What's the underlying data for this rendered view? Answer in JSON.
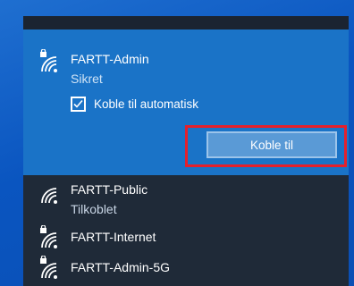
{
  "networks": [
    {
      "name": "FARTT-Admin",
      "status": "Sikret",
      "secured": true,
      "selected": true
    },
    {
      "name": "FARTT-Public",
      "status": "Tilkoblet",
      "secured": false
    },
    {
      "name": "FARTT-Internet",
      "status": "",
      "secured": true
    },
    {
      "name": "FARTT-Admin-5G",
      "status": "",
      "secured": true
    }
  ],
  "auto_connect": {
    "label": "Koble til automatisk",
    "checked": true
  },
  "connect_button": {
    "label": "Koble til"
  },
  "colors": {
    "selected_bg": "#1a73c7",
    "panel_bg": "#1f2a38",
    "highlight": "#e5202c"
  }
}
